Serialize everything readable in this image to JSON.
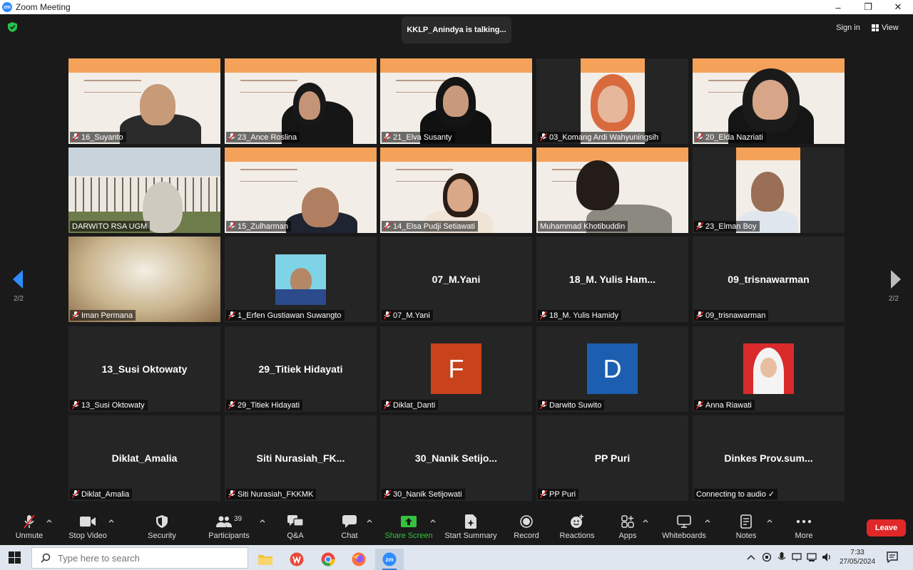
{
  "window": {
    "title": "Zoom Meeting",
    "minimize": "–",
    "restore": "❐",
    "close": "✕"
  },
  "topbar": {
    "talking": "KKLP_Anindya is talking...",
    "signin": "Sign in",
    "view": "View"
  },
  "pager": {
    "left": "2/2",
    "right": "2/2"
  },
  "tiles": [
    {
      "name": "16_Suyanto"
    },
    {
      "name": "23_Ance Roslina"
    },
    {
      "name": "21_Elva Susanty"
    },
    {
      "name": "03_Komang Ardi Wahyuningsih"
    },
    {
      "name": "20_Elda Nazriati"
    },
    {
      "name": "DARWITO RSA UGM"
    },
    {
      "name": "15_Zulharman"
    },
    {
      "name": "14_Elsa Pudji Setiawati"
    },
    {
      "name": "Muhammad Khotibuddin"
    },
    {
      "name": "23_Elman Boy"
    },
    {
      "name": "Iman Permana"
    },
    {
      "name": "1_Erfen Gustiawan Suwangto"
    },
    {
      "name": "07_M.Yani",
      "display": "07_M.Yani"
    },
    {
      "name": "18_M. Yulis Hamidy",
      "display": "18_M. Yulis Ham..."
    },
    {
      "name": "09_trisnawarman",
      "display": "09_trisnawarman"
    },
    {
      "name": "13_Susi Oktowaty",
      "display": "13_Susi Oktowaty"
    },
    {
      "name": "29_Titiek Hidayati",
      "display": "29_Titiek Hidayati"
    },
    {
      "name": "Diklat_Danti",
      "initial": "F",
      "color": "#c8431b"
    },
    {
      "name": "Darwito Suwito",
      "initial": "D",
      "color": "#1c5fb0"
    },
    {
      "name": "Anna Riawati"
    },
    {
      "name": "Diklat_Amalia",
      "display": "Diklat_Amalia"
    },
    {
      "name": "Siti Nurasiah_FKKMK",
      "display": "Siti  Nurasiah_FK..."
    },
    {
      "name": "30_Nanik Setijowati",
      "display": "30_Nanik  Setijo..."
    },
    {
      "name": "PP Puri",
      "display": "PP Puri"
    },
    {
      "name": "Connecting to audio ✓",
      "display": "Dinkes  Prov.sum..."
    }
  ],
  "toolbar": {
    "unmute": "Unmute",
    "stop_video": "Stop Video",
    "security": "Security",
    "participants": "Participants",
    "participants_count": "39",
    "qa": "Q&A",
    "chat": "Chat",
    "share_screen": "Share Screen",
    "start_summary": "Start Summary",
    "record": "Record",
    "reactions": "Reactions",
    "apps": "Apps",
    "whiteboards": "Whiteboards",
    "notes": "Notes",
    "more": "More",
    "leave": "Leave"
  },
  "taskbar": {
    "search_placeholder": "Type here to search",
    "time": "7:33",
    "date": "27/05/2024"
  },
  "colors": {
    "accent_green": "#36c13f",
    "leave_red": "#e02828",
    "zoom_blue": "#2d8cff"
  }
}
